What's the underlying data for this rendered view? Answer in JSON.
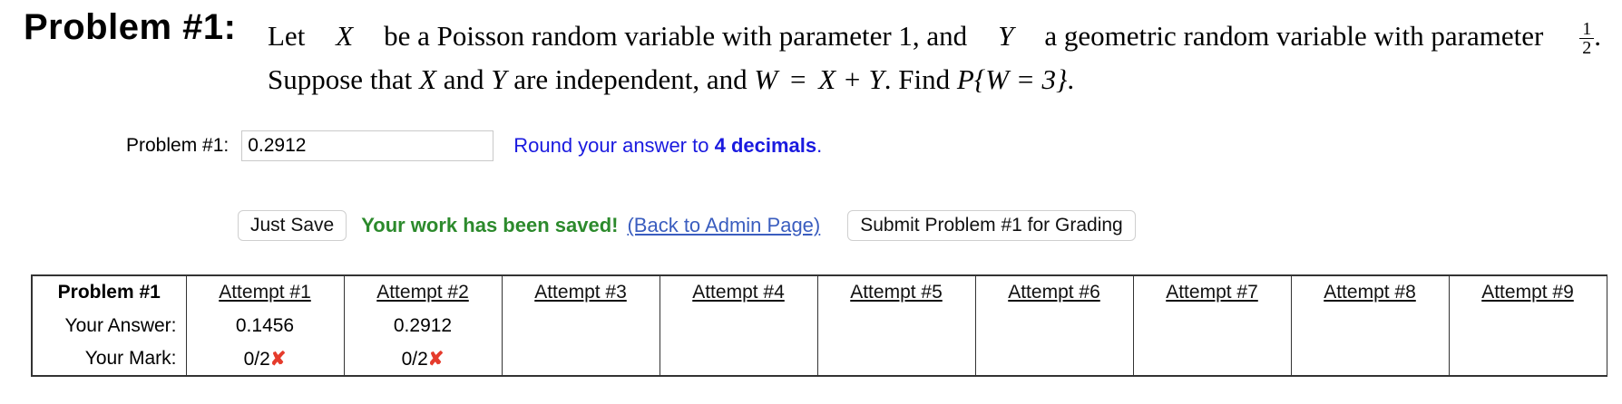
{
  "problem": {
    "header": "Problem #1:",
    "line1": {
      "part1": "Let",
      "var_x": "X",
      "part2": "be a Poisson random variable with parameter 1, and",
      "var_y": "Y",
      "part3": "a geometric random variable with parameter",
      "frac_num": "1",
      "frac_den": "2",
      "end": "."
    },
    "line2": {
      "part1": "Suppose that",
      "var_x": "X",
      "part2": "and",
      "var_y": "Y",
      "part3": "are independent, and",
      "var_w": "W",
      "eq": "=",
      "expr": "X + Y",
      "part4": ". Find",
      "prob": "P{W = 3}",
      "end": "."
    }
  },
  "answer": {
    "label": "Problem #1:",
    "value": "0.2912",
    "note_prefix": "Round your answer to",
    "note_bold": "4 decimals",
    "note_suffix": "."
  },
  "actions": {
    "just_save": "Just Save",
    "saved_msg": "Your work has been saved!",
    "admin_link": "(Back to Admin Page)",
    "submit": "Submit Problem #1 for Grading"
  },
  "attempts": {
    "header": "Problem #1",
    "columns": [
      "Attempt #1",
      "Attempt #2",
      "Attempt #3",
      "Attempt #4",
      "Attempt #5",
      "Attempt #6",
      "Attempt #7",
      "Attempt #8",
      "Attempt #9"
    ],
    "answer_label": "Your Answer:",
    "mark_label": "Your Mark:",
    "answers": [
      "0.1456",
      "0.2912",
      "",
      "",
      "",
      "",
      "",
      "",
      ""
    ],
    "marks": [
      "0/2",
      "0/2",
      "",
      "",
      "",
      "",
      "",
      "",
      ""
    ],
    "incorrect_icon": "✘",
    "incorrect_color": "#e53b2c"
  },
  "colors": {
    "note_blue": "#1a1adf",
    "saved_green": "#2c8a2c",
    "link_blue": "#3a5dbf"
  }
}
